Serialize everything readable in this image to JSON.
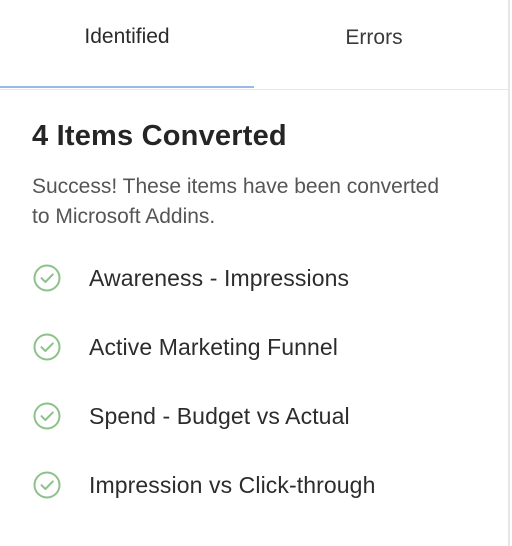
{
  "tabs": [
    {
      "label": "Identified"
    },
    {
      "label": "Errors"
    }
  ],
  "main": {
    "title": "4 Items Converted",
    "description": "Success! These items have been converted to Microsoft Addins.",
    "items": [
      {
        "label": "Awareness - Impressions"
      },
      {
        "label": "Active Marketing Funnel"
      },
      {
        "label": "Spend - Budget vs Actual"
      },
      {
        "label": "Impression vs Click-through"
      }
    ]
  },
  "icons": {
    "item_icon": "check-circle-icon"
  },
  "colors": {
    "check_green": "#8cc28a",
    "active_tab_underline": "#9bb8e6"
  }
}
